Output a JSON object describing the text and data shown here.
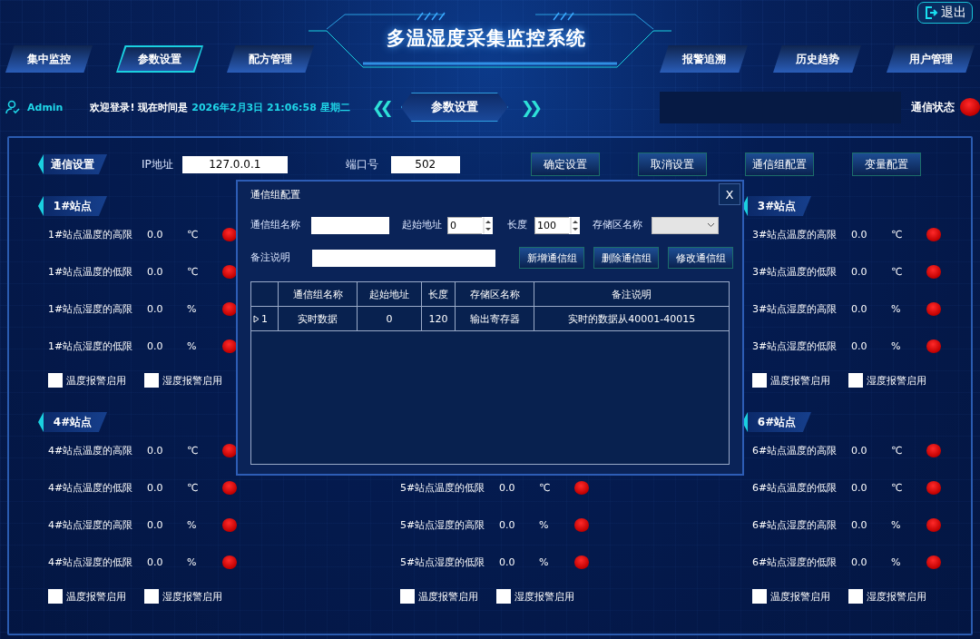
{
  "header": {
    "title": "多温湿度采集监控系统",
    "exit_button": "退出",
    "nav_left": [
      {
        "label": "集中监控",
        "selected": false
      },
      {
        "label": "参数设置",
        "selected": true
      },
      {
        "label": "配方管理",
        "selected": false
      }
    ],
    "nav_right": [
      {
        "label": "报警追溯",
        "selected": false
      },
      {
        "label": "历史趋势",
        "selected": false
      },
      {
        "label": "用户管理",
        "selected": false
      }
    ]
  },
  "info_bar": {
    "user": "Admin",
    "welcome": "欢迎登录! 现在时间是",
    "datetime": "2026年2月3日 21:06:58 星期二",
    "prev": "❮❮",
    "current_page": "参数设置",
    "next": "❯❯",
    "status_label": "通信状态",
    "status_lit": true
  },
  "comm_settings": {
    "title": "通信设置",
    "ip_label": "IP地址",
    "ip_value": "127.0.0.1",
    "port_label": "端口号",
    "port_value": "502",
    "buttons": [
      "确定设置",
      "取消设置",
      "通信组配置",
      "变量配置"
    ]
  },
  "station_rows": [
    {
      "left": {
        "title": "1#站点",
        "rows": [
          {
            "label": "1#站点温度的高限",
            "value": "0.0",
            "unit": "℃",
            "lit": true
          },
          {
            "label": "1#站点温度的低限",
            "value": "0.0",
            "unit": "℃",
            "lit": true
          },
          {
            "label": "1#站点湿度的高限",
            "value": "0.0",
            "unit": "%",
            "lit": true
          },
          {
            "label": "1#站点湿度的低限",
            "value": "0.0",
            "unit": "%",
            "lit": true
          }
        ],
        "checks": [
          {
            "label": "温度报警启用",
            "checked": false
          },
          {
            "label": "湿度报警启用",
            "checked": false
          }
        ]
      },
      "right": {
        "title": "3#站点",
        "rows": [
          {
            "label": "3#站点温度的高限",
            "value": "0.0",
            "unit": "℃",
            "lit": true
          },
          {
            "label": "3#站点温度的低限",
            "value": "0.0",
            "unit": "℃",
            "lit": true
          },
          {
            "label": "3#站点湿度的高限",
            "value": "0.0",
            "unit": "%",
            "lit": true
          },
          {
            "label": "3#站点湿度的低限",
            "value": "0.0",
            "unit": "%",
            "lit": true
          }
        ],
        "checks": [
          {
            "label": "温度报警启用",
            "checked": false
          },
          {
            "label": "湿度报警启用",
            "checked": false
          }
        ]
      }
    },
    {
      "left": {
        "title": "4#站点",
        "rows": [
          {
            "label": "4#站点温度的高限",
            "value": "0.0",
            "unit": "℃",
            "lit": true
          },
          {
            "label": "4#站点温度的低限",
            "value": "0.0",
            "unit": "℃",
            "lit": true
          },
          {
            "label": "4#站点湿度的高限",
            "value": "0.0",
            "unit": "%",
            "lit": true
          },
          {
            "label": "4#站点湿度的低限",
            "value": "0.0",
            "unit": "%",
            "lit": true
          }
        ],
        "checks": [
          {
            "label": "温度报警启用",
            "checked": false
          },
          {
            "label": "湿度报警启用",
            "checked": false
          }
        ]
      },
      "middle": {
        "rows": [
          {
            "label": "5#站点温度的低限",
            "value": "0.0",
            "unit": "℃",
            "lit": true
          },
          {
            "label": "5#站点湿度的高限",
            "value": "0.0",
            "unit": "%",
            "lit": true
          },
          {
            "label": "5#站点湿度的低限",
            "value": "0.0",
            "unit": "%",
            "lit": true
          }
        ],
        "checks": [
          {
            "label": "温度报警启用",
            "checked": false
          },
          {
            "label": "湿度报警启用",
            "checked": false
          }
        ]
      },
      "right": {
        "title": "6#站点",
        "rows": [
          {
            "label": "6#站点温度的高限",
            "value": "0.0",
            "unit": "℃",
            "lit": true
          },
          {
            "label": "6#站点温度的低限",
            "value": "0.0",
            "unit": "℃",
            "lit": true
          },
          {
            "label": "6#站点湿度的高限",
            "value": "0.0",
            "unit": "%",
            "lit": true
          },
          {
            "label": "6#站点湿度的低限",
            "value": "0.0",
            "unit": "%",
            "lit": true
          }
        ],
        "checks": [
          {
            "label": "温度报警启用",
            "checked": false
          },
          {
            "label": "湿度报警启用",
            "checked": false
          }
        ]
      }
    }
  ],
  "dialog": {
    "title": "通信组配置",
    "close": "X",
    "name_label": "通信组名称",
    "start_label": "起始地址",
    "start_value": "0",
    "length_label": "长度",
    "length_value": "100",
    "area_label": "存储区名称",
    "note_label": "备注说明",
    "buttons": [
      "新增通信组",
      "删除通信组",
      "修改通信组"
    ],
    "table": {
      "columns": [
        "通信组名称",
        "起始地址",
        "长度",
        "存储区名称",
        "备注说明"
      ],
      "rows": [
        {
          "index": "1",
          "current": true,
          "cells": [
            "实时数据",
            "0",
            "120",
            "输出寄存器",
            "实时的数据从40001-40015"
          ]
        }
      ]
    }
  }
}
